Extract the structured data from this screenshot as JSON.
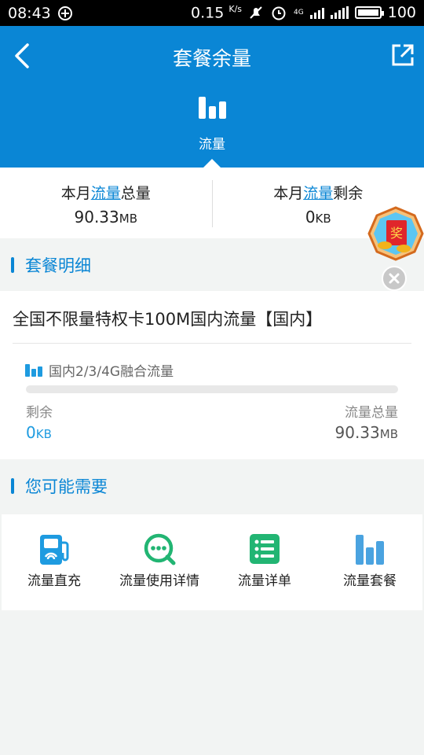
{
  "status_bar": {
    "time": "08:43",
    "speed": "0.15",
    "speed_unit": "K/s",
    "network": "4G",
    "battery": "100"
  },
  "header": {
    "title": "套餐余量",
    "tab_label": "流量"
  },
  "summary": {
    "total": {
      "prefix": "本月",
      "highlight": "流量",
      "suffix": "总量",
      "value": "90.33",
      "unit": "MB"
    },
    "remaining": {
      "prefix": "本月",
      "highlight": "流量",
      "suffix": "剩余",
      "value": "0",
      "unit": "KB"
    }
  },
  "detail_section": {
    "title": "套餐明细",
    "package_name": "全国不限量特权卡100M国内流量【国内】",
    "traffic_type": "国内2/3/4G融合流量",
    "used_fraction": 0,
    "remaining_label": "剩余",
    "remaining_value": "0",
    "remaining_unit": "KB",
    "total_label": "流量总量",
    "total_value": "90.33",
    "total_unit": "MB"
  },
  "services_section": {
    "title": "您可能需要",
    "items": [
      {
        "label": "流量直充",
        "icon": "recharge-station-icon",
        "color": "#1e9be0"
      },
      {
        "label": "流量使用详情",
        "icon": "chat-search-icon",
        "color": "#22b573"
      },
      {
        "label": "流量详单",
        "icon": "list-icon",
        "color": "#22b573"
      },
      {
        "label": "流量套餐",
        "icon": "bar-chart-icon",
        "color": "#4aa3e0"
      }
    ]
  },
  "floating": {
    "red_packet_text": "奖"
  },
  "colors": {
    "brand": "#0a86d5",
    "accent_value": "#1e9be0",
    "background": "#f2f4f3"
  }
}
